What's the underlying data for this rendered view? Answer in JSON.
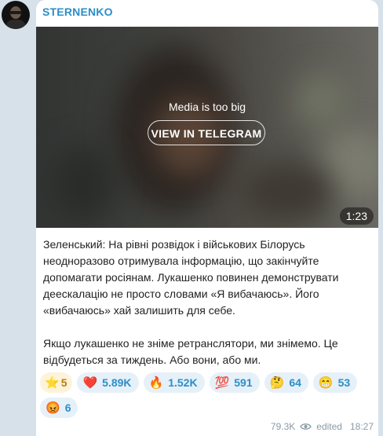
{
  "post": {
    "channel_name": "STERNENKO",
    "media": {
      "message": "Media is too big",
      "button_label": "VIEW IN TELEGRAM",
      "duration": "1:23"
    },
    "paragraph_1": "Зеленський: На рівні розвідок і військових Білорусь неодноразово отримувала інформацію, що закінчуйте допомагати росіянам. Лукашенко повинен демонструвати деескалацію не просто словами «Я вибачаюсь». Його «вибачаюсь» хай залишить для себе.",
    "paragraph_2": "Якщо лукашенко не зніме ретранслятори, ми знімемо. Це відбудеться за тиждень. Або вони, або ми.",
    "reactions": [
      {
        "emoji": "⭐",
        "count": "5",
        "icon": "star-icon"
      },
      {
        "emoji": "❤️",
        "count": "5.89K",
        "icon": "heart-icon"
      },
      {
        "emoji": "🔥",
        "count": "1.52K",
        "icon": "fire-icon"
      },
      {
        "emoji": "💯",
        "count": "591",
        "icon": "hundred-icon"
      },
      {
        "emoji": "🤔",
        "count": "64",
        "icon": "thinking-face-icon"
      },
      {
        "emoji": "😁",
        "count": "53",
        "icon": "grin-icon"
      },
      {
        "emoji": "😡",
        "count": "6",
        "icon": "angry-face-icon"
      }
    ],
    "footer": {
      "views": "79.3K",
      "edited_label": "edited",
      "time": "18:27"
    }
  },
  "colors": {
    "accent": "#2b8ec6",
    "background": "#d7e1ea",
    "reaction_bg": "#e6f0f8",
    "paid_reaction_bg": "#fdf3d8"
  }
}
